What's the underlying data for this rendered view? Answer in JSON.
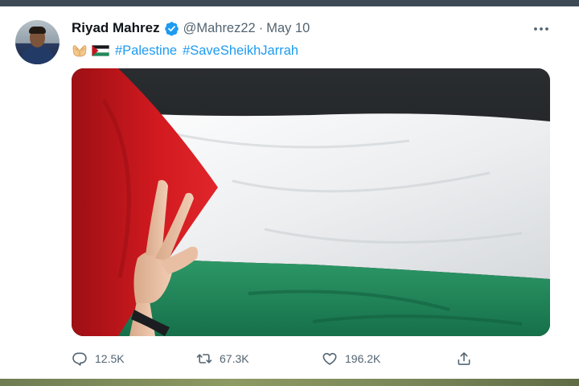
{
  "tweet": {
    "author_name": "Riyad Mahrez",
    "handle": "@Mahrez22",
    "separator": "·",
    "date": "May 10",
    "hashtags": [
      "#Palestine",
      "#SaveSheikhJarrah"
    ],
    "emoji_icons": [
      "palms-up-together-icon",
      "palestine-flag-icon"
    ],
    "media_alt": "palestinian-flag-photo"
  },
  "actions": {
    "reply_count": "12.5K",
    "retweet_count": "67.3K",
    "like_count": "196.2K"
  },
  "colors": {
    "link": "#1d9bf0",
    "secondary_text": "#536471",
    "verified": "#1d9bf0",
    "flag_red": "#c6161b",
    "flag_green": "#1f8a59",
    "flag_black": "#15181b"
  }
}
